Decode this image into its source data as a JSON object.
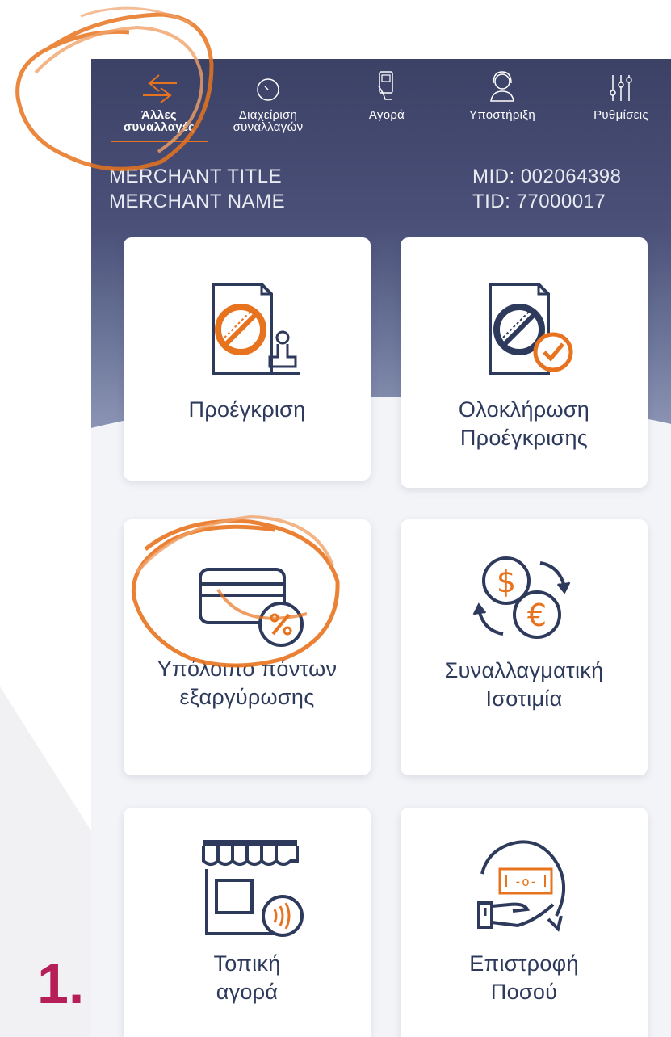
{
  "tabs": [
    {
      "label_line1": "Άλλες",
      "label_line2": "συναλλαγές",
      "icon": "arrows-exchange-icon",
      "active": true
    },
    {
      "label_line1": "Διαχείριση",
      "label_line2": "συναλλαγών",
      "icon": "clock-icon",
      "active": false
    },
    {
      "label_line1": "Αγορά",
      "label_line2": "",
      "icon": "card-hand-icon",
      "active": false
    },
    {
      "label_line1": "Υποστήριξη",
      "label_line2": "",
      "icon": "headset-support-icon",
      "active": false
    },
    {
      "label_line1": "Ρυθμίσεις",
      "label_line2": "",
      "icon": "sliders-icon",
      "active": false
    }
  ],
  "merchant": {
    "title": "MERCHANT TITLE",
    "name": "MERCHANT NAME",
    "mid": "MID: 002064398",
    "tid": "TID: 77000017"
  },
  "cards": [
    {
      "label": "Προέγκριση",
      "icon": "document-stamp-icon"
    },
    {
      "label": "Ολοκλήρωση Προέγκρισης",
      "icon": "document-check-icon"
    },
    {
      "label": "Υπόλοιπο πόντων εξαργύρωσης",
      "icon": "card-percent-icon"
    },
    {
      "label": "Συναλλαγματική Ισοτιμία",
      "icon": "currency-exchange-icon"
    },
    {
      "label": "Τοπική αγορά",
      "icon": "shop-contactless-icon"
    },
    {
      "label": "Επιστροφή Ποσού",
      "icon": "hand-money-refund-icon"
    }
  ],
  "annotation": {
    "step_number": "1."
  },
  "colors": {
    "header": "#3c4166",
    "accent": "#e8731e",
    "icon_navy": "#2e3a5c",
    "step": "#b61e58"
  }
}
